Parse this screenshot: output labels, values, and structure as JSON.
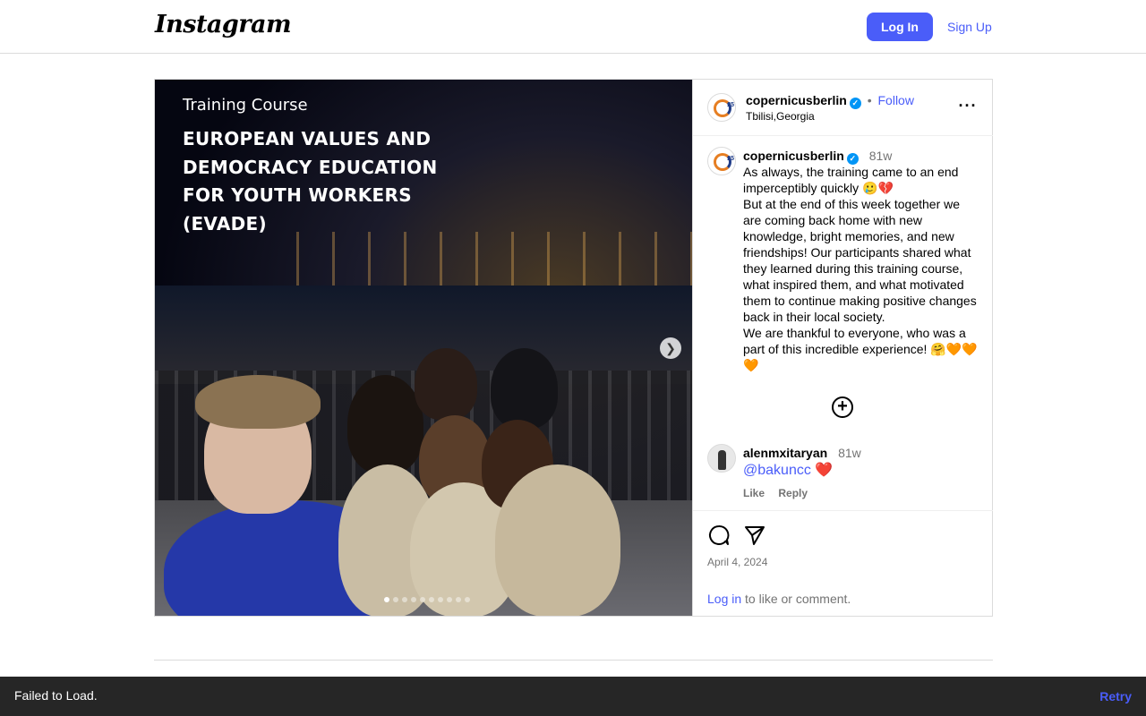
{
  "header": {
    "logo_text": "Instagram",
    "login_label": "Log In",
    "signup_label": "Sign Up"
  },
  "post": {
    "media": {
      "subtitle": "Training Course",
      "title": "European values and democracy education for youth workers (EVADE)",
      "slide_count": 10,
      "active_slide": 1
    },
    "author": {
      "username": "copernicusberlin",
      "verified": true,
      "separator": "•",
      "follow_label": "Follow",
      "location": "Tbilisi,Georgia"
    },
    "caption": {
      "username": "copernicusberlin",
      "time": "81w",
      "text": "As always, the training came to an end imperceptibly quickly 🥲💔\nBut at the end of this week together we are coming back home with new knowledge, bright memories, and new friendships! Our participants shared what they learned during this training course, what inspired them, and what motivated them to continue making positive changes back in their local society.\nWe are thankful to everyone, who was a part of this incredible experience! 🤗🧡🧡🧡"
    },
    "comment": {
      "username": "alenmxitaryan",
      "time": "81w",
      "mention": "@bakuncc",
      "emoji": "❤️",
      "like_label": "Like",
      "reply_label": "Reply"
    },
    "date": "April 4, 2024",
    "login_prompt": {
      "link": "Log in",
      "rest": " to like or comment."
    }
  },
  "snackbar": {
    "message": "Failed to Load.",
    "retry_label": "Retry"
  },
  "colors": {
    "accent": "#4a5df9",
    "snackbar_bg": "#262626",
    "verified": "#0095f6"
  },
  "icons": [
    "more-options-icon",
    "chevron-right-icon",
    "plus-circle-icon",
    "comment-icon",
    "share-icon",
    "verified-badge-icon"
  ]
}
